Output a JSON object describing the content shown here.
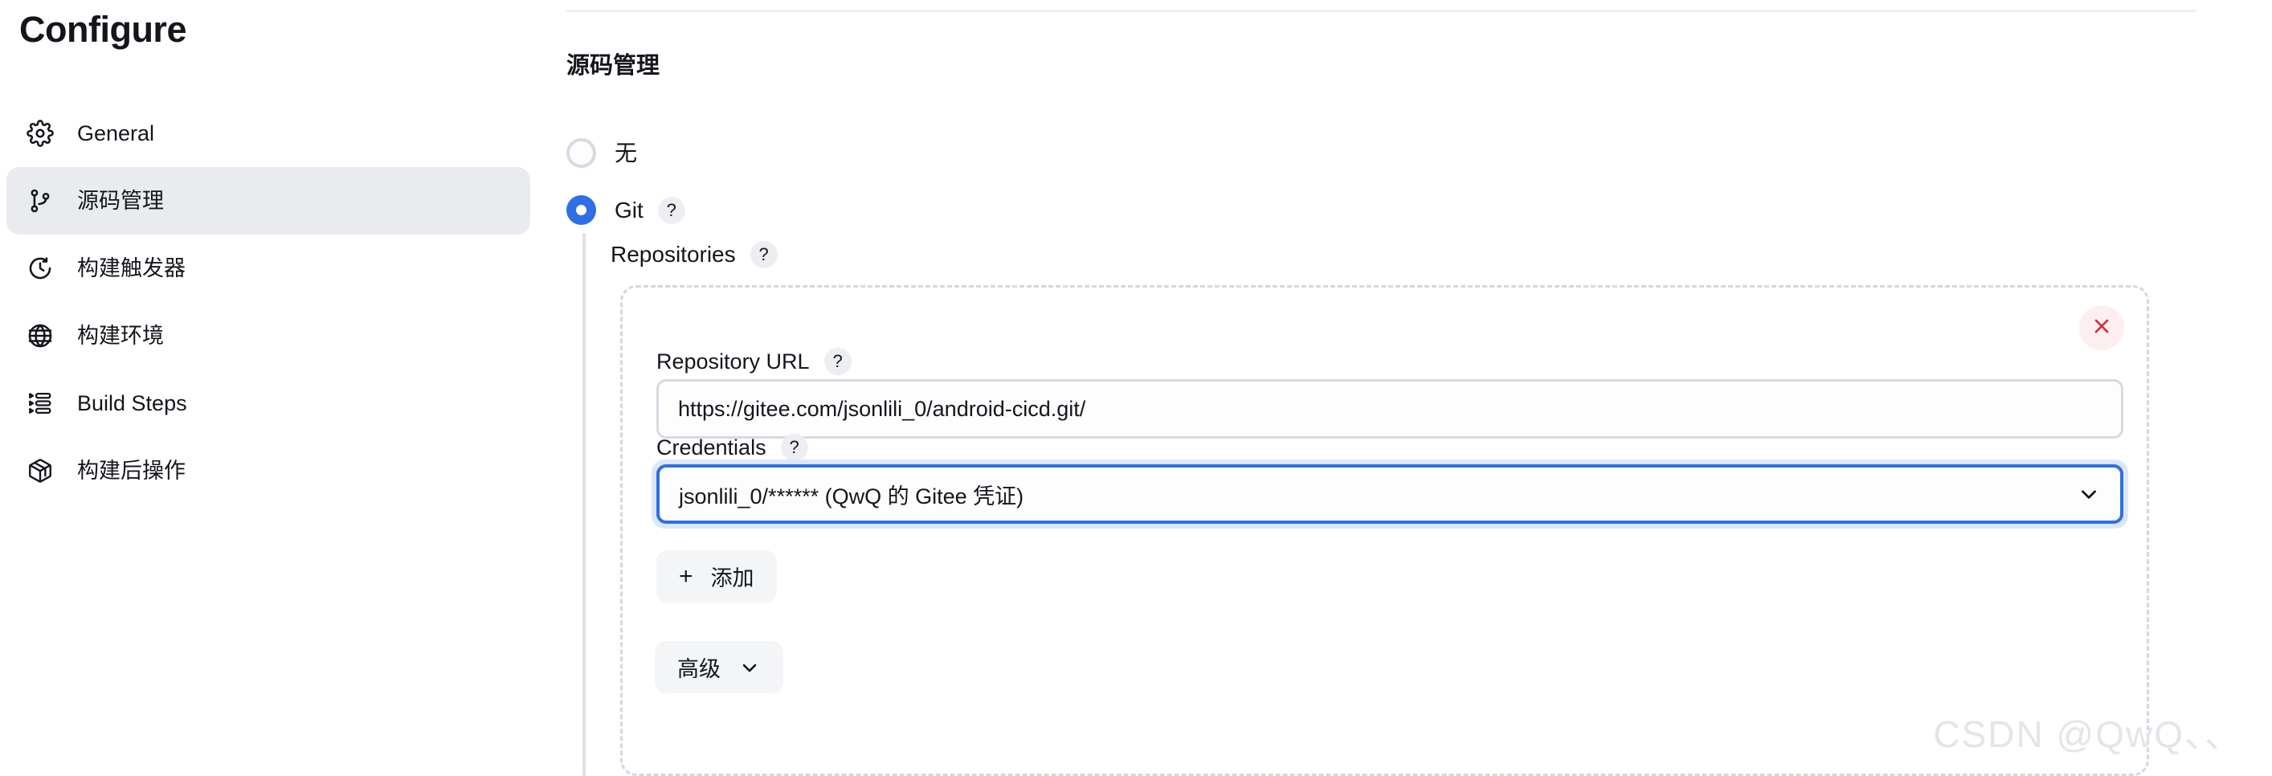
{
  "sidebar": {
    "title": "Configure",
    "items": [
      {
        "label": "General",
        "icon": "gear-icon",
        "active": false
      },
      {
        "label": "源码管理",
        "icon": "git-branch-icon",
        "active": true
      },
      {
        "label": "构建触发器",
        "icon": "clock-icon",
        "active": false
      },
      {
        "label": "构建环境",
        "icon": "globe-icon",
        "active": false
      },
      {
        "label": "Build Steps",
        "icon": "list-steps-icon",
        "active": false
      },
      {
        "label": "构建后操作",
        "icon": "package-icon",
        "active": false
      }
    ]
  },
  "main": {
    "section_title": "源码管理",
    "scm_options": [
      {
        "label": "无",
        "selected": false,
        "help": ""
      },
      {
        "label": "Git",
        "selected": true,
        "help": "?"
      }
    ],
    "repositories_label": "Repositories",
    "repositories_help": "?",
    "repository": {
      "delete_icon": "close-icon",
      "url_label": "Repository URL",
      "url_help": "?",
      "url_value": "https://gitee.com/jsonlili_0/android-cicd.git/",
      "url_placeholder": "",
      "credentials_label": "Credentials",
      "credentials_help": "?",
      "credentials_value": "jsonlili_0/****** (QwQ 的 Gitee 凭证)",
      "add_button": "添加",
      "add_icon": "plus-icon",
      "advanced_button": "高级",
      "advanced_icon": "chevron-down-icon",
      "dropdown_icon": "chevron-down-icon"
    }
  },
  "watermark": "CSDN @QwQ、、",
  "colors": {
    "accent": "#2f6fe4",
    "danger": "#d62c3a",
    "active_bg": "#e9ebef",
    "border": "#d6dae1",
    "dashed_border": "#d2d8e0"
  }
}
